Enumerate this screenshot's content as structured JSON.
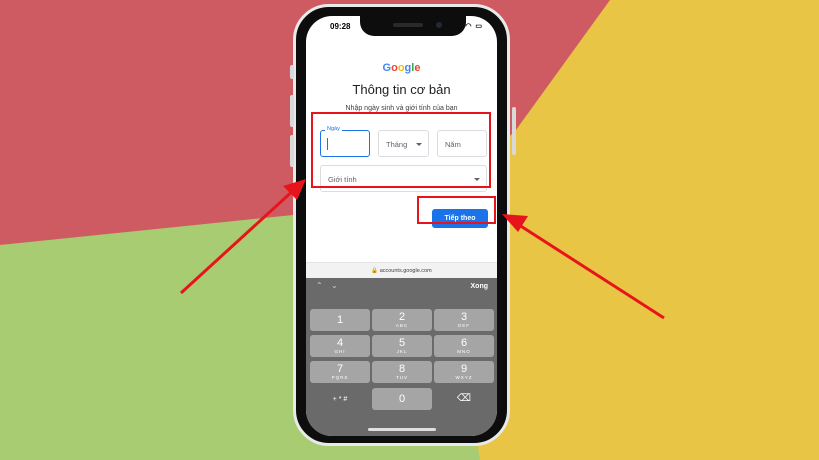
{
  "status_bar": {
    "time": "09:28",
    "icons": "▂▄▆ ◠ ▭"
  },
  "page": {
    "logo_letters": [
      {
        "ch": "G",
        "color": "#4285F4"
      },
      {
        "ch": "o",
        "color": "#EA4335"
      },
      {
        "ch": "o",
        "color": "#FBBC05"
      },
      {
        "ch": "g",
        "color": "#4285F4"
      },
      {
        "ch": "l",
        "color": "#34A853"
      },
      {
        "ch": "e",
        "color": "#EA4335"
      }
    ],
    "title": "Thông tin cơ bản",
    "subtitle": "Nhập ngày sinh và giới tính của bạn",
    "day_label": "Ngày",
    "month_placeholder": "Tháng",
    "year_placeholder": "Năm",
    "gender_placeholder": "Giới tính",
    "next_label": "Tiếp theo"
  },
  "browser": {
    "url": "🔒 accounts.google.com"
  },
  "keyboard": {
    "up_arrow": "⌃",
    "down_arrow": "⌄",
    "done": "Xong",
    "keys": [
      {
        "n": "1",
        "l": ""
      },
      {
        "n": "2",
        "l": "ABC"
      },
      {
        "n": "3",
        "l": "DEF"
      },
      {
        "n": "4",
        "l": "GHI"
      },
      {
        "n": "5",
        "l": "JKL"
      },
      {
        "n": "6",
        "l": "MNO"
      },
      {
        "n": "7",
        "l": "PQRS"
      },
      {
        "n": "8",
        "l": "TUV"
      },
      {
        "n": "9",
        "l": "WXYZ"
      },
      {
        "n": "+ * #",
        "l": ""
      },
      {
        "n": "0",
        "l": ""
      },
      {
        "n": "⌫",
        "l": ""
      }
    ]
  },
  "colors": {
    "accent": "#1a73e8",
    "highlight": "#e8141b",
    "bg_red": "#cf5b62",
    "bg_green": "#a8cc72",
    "bg_yellow": "#e9c546"
  }
}
